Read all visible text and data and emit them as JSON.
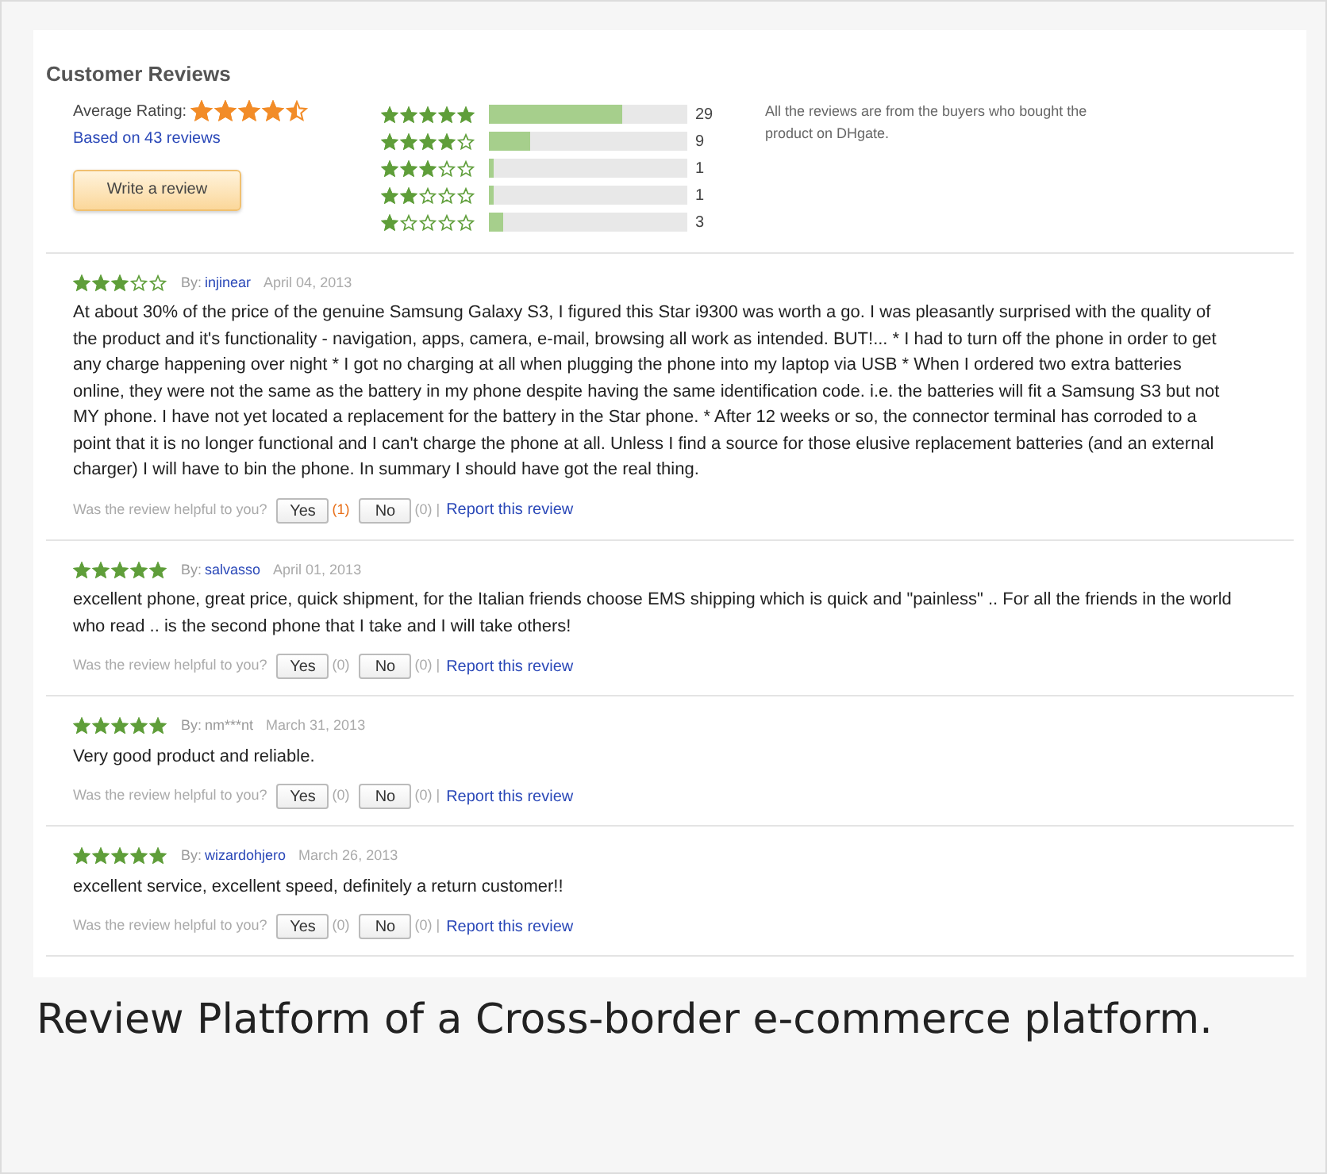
{
  "title": "Customer Reviews",
  "summary": {
    "average_label": "Average Rating:",
    "stars": 4.5,
    "based_on": "Based on 43 reviews",
    "write_button": "Write a review",
    "note": "All the reviews are from the buyers who bought the product on DHgate."
  },
  "distribution": [
    {
      "stars": 5,
      "level": 0.674,
      "count": "29"
    },
    {
      "stars": 4,
      "level": 0.209,
      "count": "9"
    },
    {
      "stars": 3,
      "level": 0.023,
      "count": "1"
    },
    {
      "stars": 2,
      "level": 0.023,
      "count": "1"
    },
    {
      "stars": 1,
      "level": 0.07,
      "count": "3"
    }
  ],
  "reviews": [
    {
      "stars": 3,
      "by_label": "By:",
      "author": "injinear",
      "author_linked": true,
      "date": "April 04, 2013",
      "text": "At about 30% of the price of the genuine Samsung Galaxy S3, I figured this Star i9300 was worth a go. I was pleasantly surprised with the quality of the product and it's functionality - navigation, apps, camera, e-mail, browsing all work as intended. BUT!... * I had to turn off the phone in order to get any charge happening over night * I got no charging at all when plugging the phone into my laptop via USB * When I ordered two extra batteries online, they were not the same as the battery in my phone despite having the same identification code. i.e. the batteries will fit a Samsung S3 but not MY phone. I have not yet located a replacement for the battery in the Star phone. * After 12 weeks or so, the connector terminal has corroded to a point that it is no longer functional and I can't charge the phone at all. Unless I find a source for those elusive replacement batteries (and an external charger) I will have to bin the phone. In summary I should have got the real thing.",
      "helpful_label": "Was the review helpful to you?",
      "yes": "Yes",
      "yes_count": "(1)",
      "yes_highlighted": true,
      "no": "No",
      "no_count": "(0) |",
      "report": "Report this review"
    },
    {
      "stars": 5,
      "by_label": "By:",
      "author": "salvasso",
      "author_linked": true,
      "date": "April 01, 2013",
      "text": "excellent phone, great price, quick shipment, for the Italian friends choose EMS shipping which is quick and \"painless\" .. For all the friends in the world who read .. is the second phone that I take and I will take others!",
      "helpful_label": "Was the review helpful to you?",
      "yes": "Yes",
      "yes_count": "(0)",
      "yes_highlighted": false,
      "no": "No",
      "no_count": "(0) |",
      "report": "Report this review"
    },
    {
      "stars": 5,
      "by_label": "By:",
      "author": "nm***nt",
      "author_linked": false,
      "date": "March 31, 2013",
      "text": "Very good product and reliable.",
      "helpful_label": "Was the review helpful to you?",
      "yes": "Yes",
      "yes_count": "(0)",
      "yes_highlighted": false,
      "no": "No",
      "no_count": "(0) |",
      "report": "Report this review"
    },
    {
      "stars": 5,
      "by_label": "By:",
      "author": "wizardohjero",
      "author_linked": true,
      "date": "March 26, 2013",
      "text": "excellent service, excellent speed, definitely a return customer!!",
      "helpful_label": "Was the review helpful to you?",
      "yes": "Yes",
      "yes_count": "(0)",
      "yes_highlighted": false,
      "no": "No",
      "no_count": "(0) |",
      "report": "Report this review"
    }
  ],
  "caption": "Review Platform of a Cross-border e-commerce platform."
}
